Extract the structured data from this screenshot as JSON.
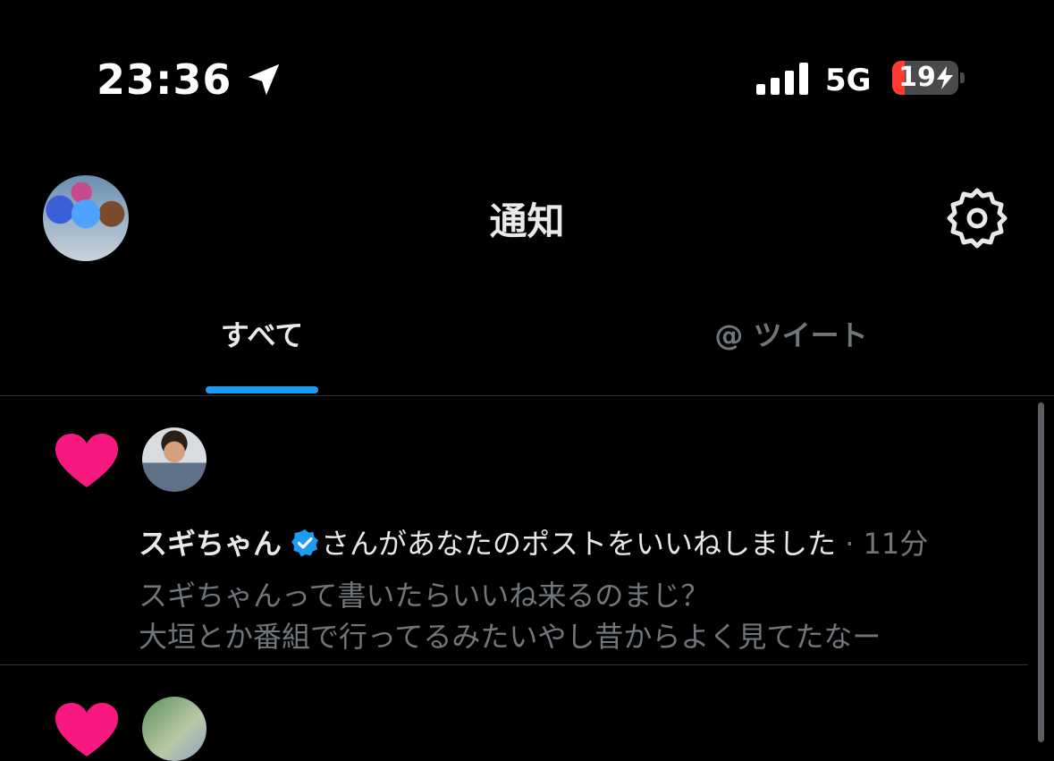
{
  "status_bar": {
    "time": "23:36",
    "network": "5G",
    "battery": "19",
    "battery_level_percent": 19
  },
  "header": {
    "title": "通知",
    "avatar_icon": "profile-avatar",
    "settings_icon": "gear-icon"
  },
  "tabs": [
    {
      "label": "すべて",
      "active": true
    },
    {
      "label": "@ ツイート",
      "active": false
    }
  ],
  "notifications": [
    {
      "type_icon": "heart-icon",
      "user_name": "スギちゃん",
      "verified": true,
      "action": "さんがあなたのポストをいいねしました",
      "separator": " · ",
      "time": "11分",
      "post_lines": [
        "スギちゃんって書いたらいいね来るのまじ？",
        "大垣とか番組で行ってるみたいやし昔からよく見てたなー"
      ]
    },
    {
      "type_icon": "heart-icon"
    }
  ],
  "colors": {
    "accent": "#1d9bf0",
    "heart": "#f91880",
    "background": "#000000",
    "muted": "#71767b"
  }
}
